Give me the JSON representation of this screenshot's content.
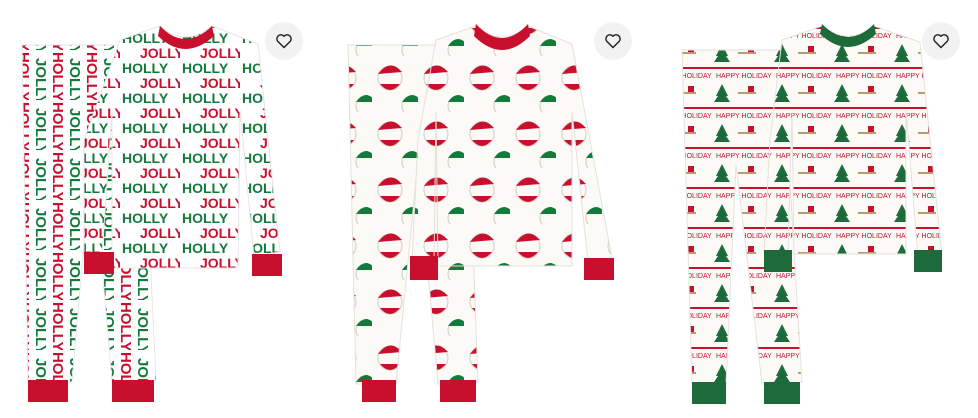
{
  "products": [
    {
      "name_icon": "heart-icon",
      "print_text": "HOLLY JOLLY",
      "colors": {
        "red": "#c8102e",
        "green": "#137a3c",
        "base": "#ffffff"
      }
    },
    {
      "name_icon": "heart-icon",
      "print_text": "",
      "colors": {
        "red": "#c8102e",
        "green": "#137a3c",
        "base": "#fbfaf6"
      }
    },
    {
      "name_icon": "heart-icon",
      "print_text": "HAPPY HOLIDAYS",
      "colors": {
        "red": "#c8102e",
        "green": "#1d6b3a",
        "tan": "#b79b74",
        "base": "#fbfaf7"
      }
    }
  ]
}
